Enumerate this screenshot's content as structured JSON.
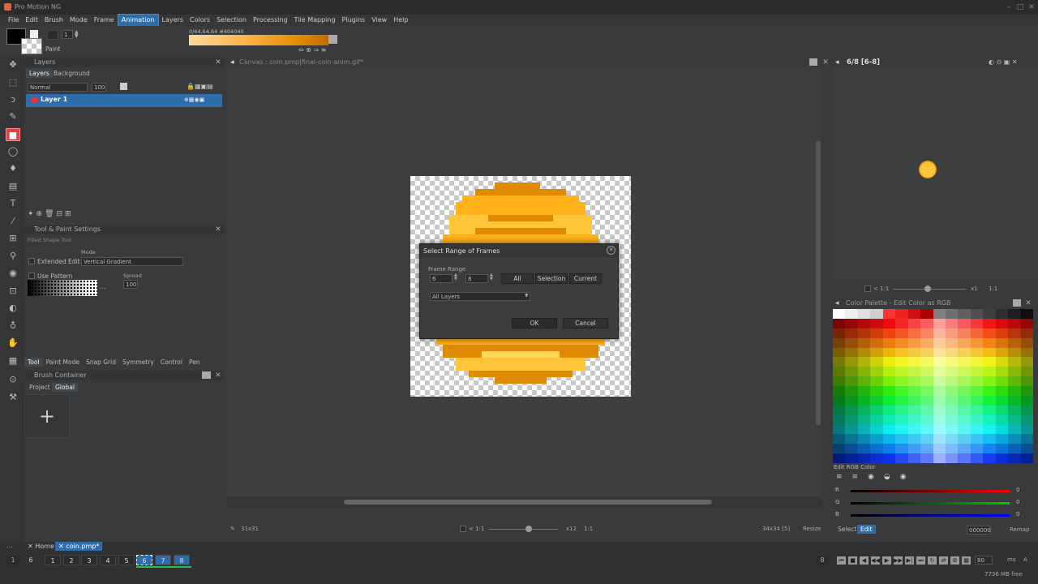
{
  "app": {
    "title": "Pro Motion NG"
  },
  "menu": [
    "File",
    "Edit",
    "Brush",
    "Mode",
    "Frame",
    "Animation",
    "Layers",
    "Colors",
    "Selection",
    "Processing",
    "Tile Mapping",
    "Plugins",
    "View",
    "Help"
  ],
  "menu_active": "Animation",
  "tool_options": {
    "brush_size": "1",
    "paint_label": "Paint",
    "color_info": "0/64,64,64 #404040"
  },
  "layers_panel": {
    "title": "Layers",
    "tabs": [
      "Layers",
      "Background"
    ],
    "blend_mode": "Normal",
    "opacity": "100",
    "layer_name": "Layer 1"
  },
  "tool_settings": {
    "title": "Tool & Paint Settings",
    "subtitle": "Filled Shape Tool",
    "mode_label": "Mode",
    "extended_edit": "Extended Edit",
    "mode_value": "Vertical Gradient",
    "use_pattern": "Use Pattern",
    "spread_label": "Spread",
    "spread_value": "100",
    "more": "...",
    "tabs": [
      "Tool",
      "Paint Mode",
      "Snap Grid",
      "Symmetry",
      "Control",
      "Pen"
    ]
  },
  "brush_container": {
    "title": "Brush Container",
    "tabs": [
      "Project",
      "Global"
    ],
    "add": "+"
  },
  "canvas": {
    "title": "Canvas : coin.pmp|final-coin-anim.gif*",
    "size": "31x31",
    "zoom_ratio": "< 1:1",
    "zoom": "x12",
    "zoom_one": "1:1",
    "dims": "34x34 [5]",
    "resize": "Resize"
  },
  "dialog": {
    "title": "Select Range of Frames",
    "frame_range_label": "Frame Range",
    "from": "6",
    "to": "8",
    "btn_all": "All",
    "btn_selection": "Selection",
    "btn_current": "Current",
    "layers_option": "All Layers",
    "ok": "OK",
    "cancel": "Cancel"
  },
  "preview": {
    "title": "6/8  [6-8]",
    "ratio": "< 1:1",
    "zoom": "x1",
    "one": "1:1"
  },
  "palette": {
    "title": "Color Palette - Edit Color as RGB",
    "edit_title": "Edit RGB Color",
    "r_label": "R",
    "g_label": "G",
    "b_label": "B",
    "r_value": "0",
    "g_value": "0",
    "b_value": "0",
    "select_tab": "Select",
    "edit_tab": "Edit",
    "hex": "000000",
    "remap": "Remap"
  },
  "bottom_tabs": {
    "more": "...",
    "home": "Home",
    "project": "coin.pmp*"
  },
  "timeline": {
    "layer_num": "1",
    "current": "6",
    "frames": [
      "1",
      "2",
      "3",
      "4",
      "5",
      "6",
      "7",
      "8"
    ],
    "selected_frame": "6",
    "frame_count": "8",
    "speed": "80",
    "unit": "ms",
    "a_btn": "A",
    "memory": "7736 MB free"
  },
  "colors": {
    "accent": "#2d6dab",
    "coin_dark": "#e08a00",
    "coin_light": "#ffc63a"
  }
}
